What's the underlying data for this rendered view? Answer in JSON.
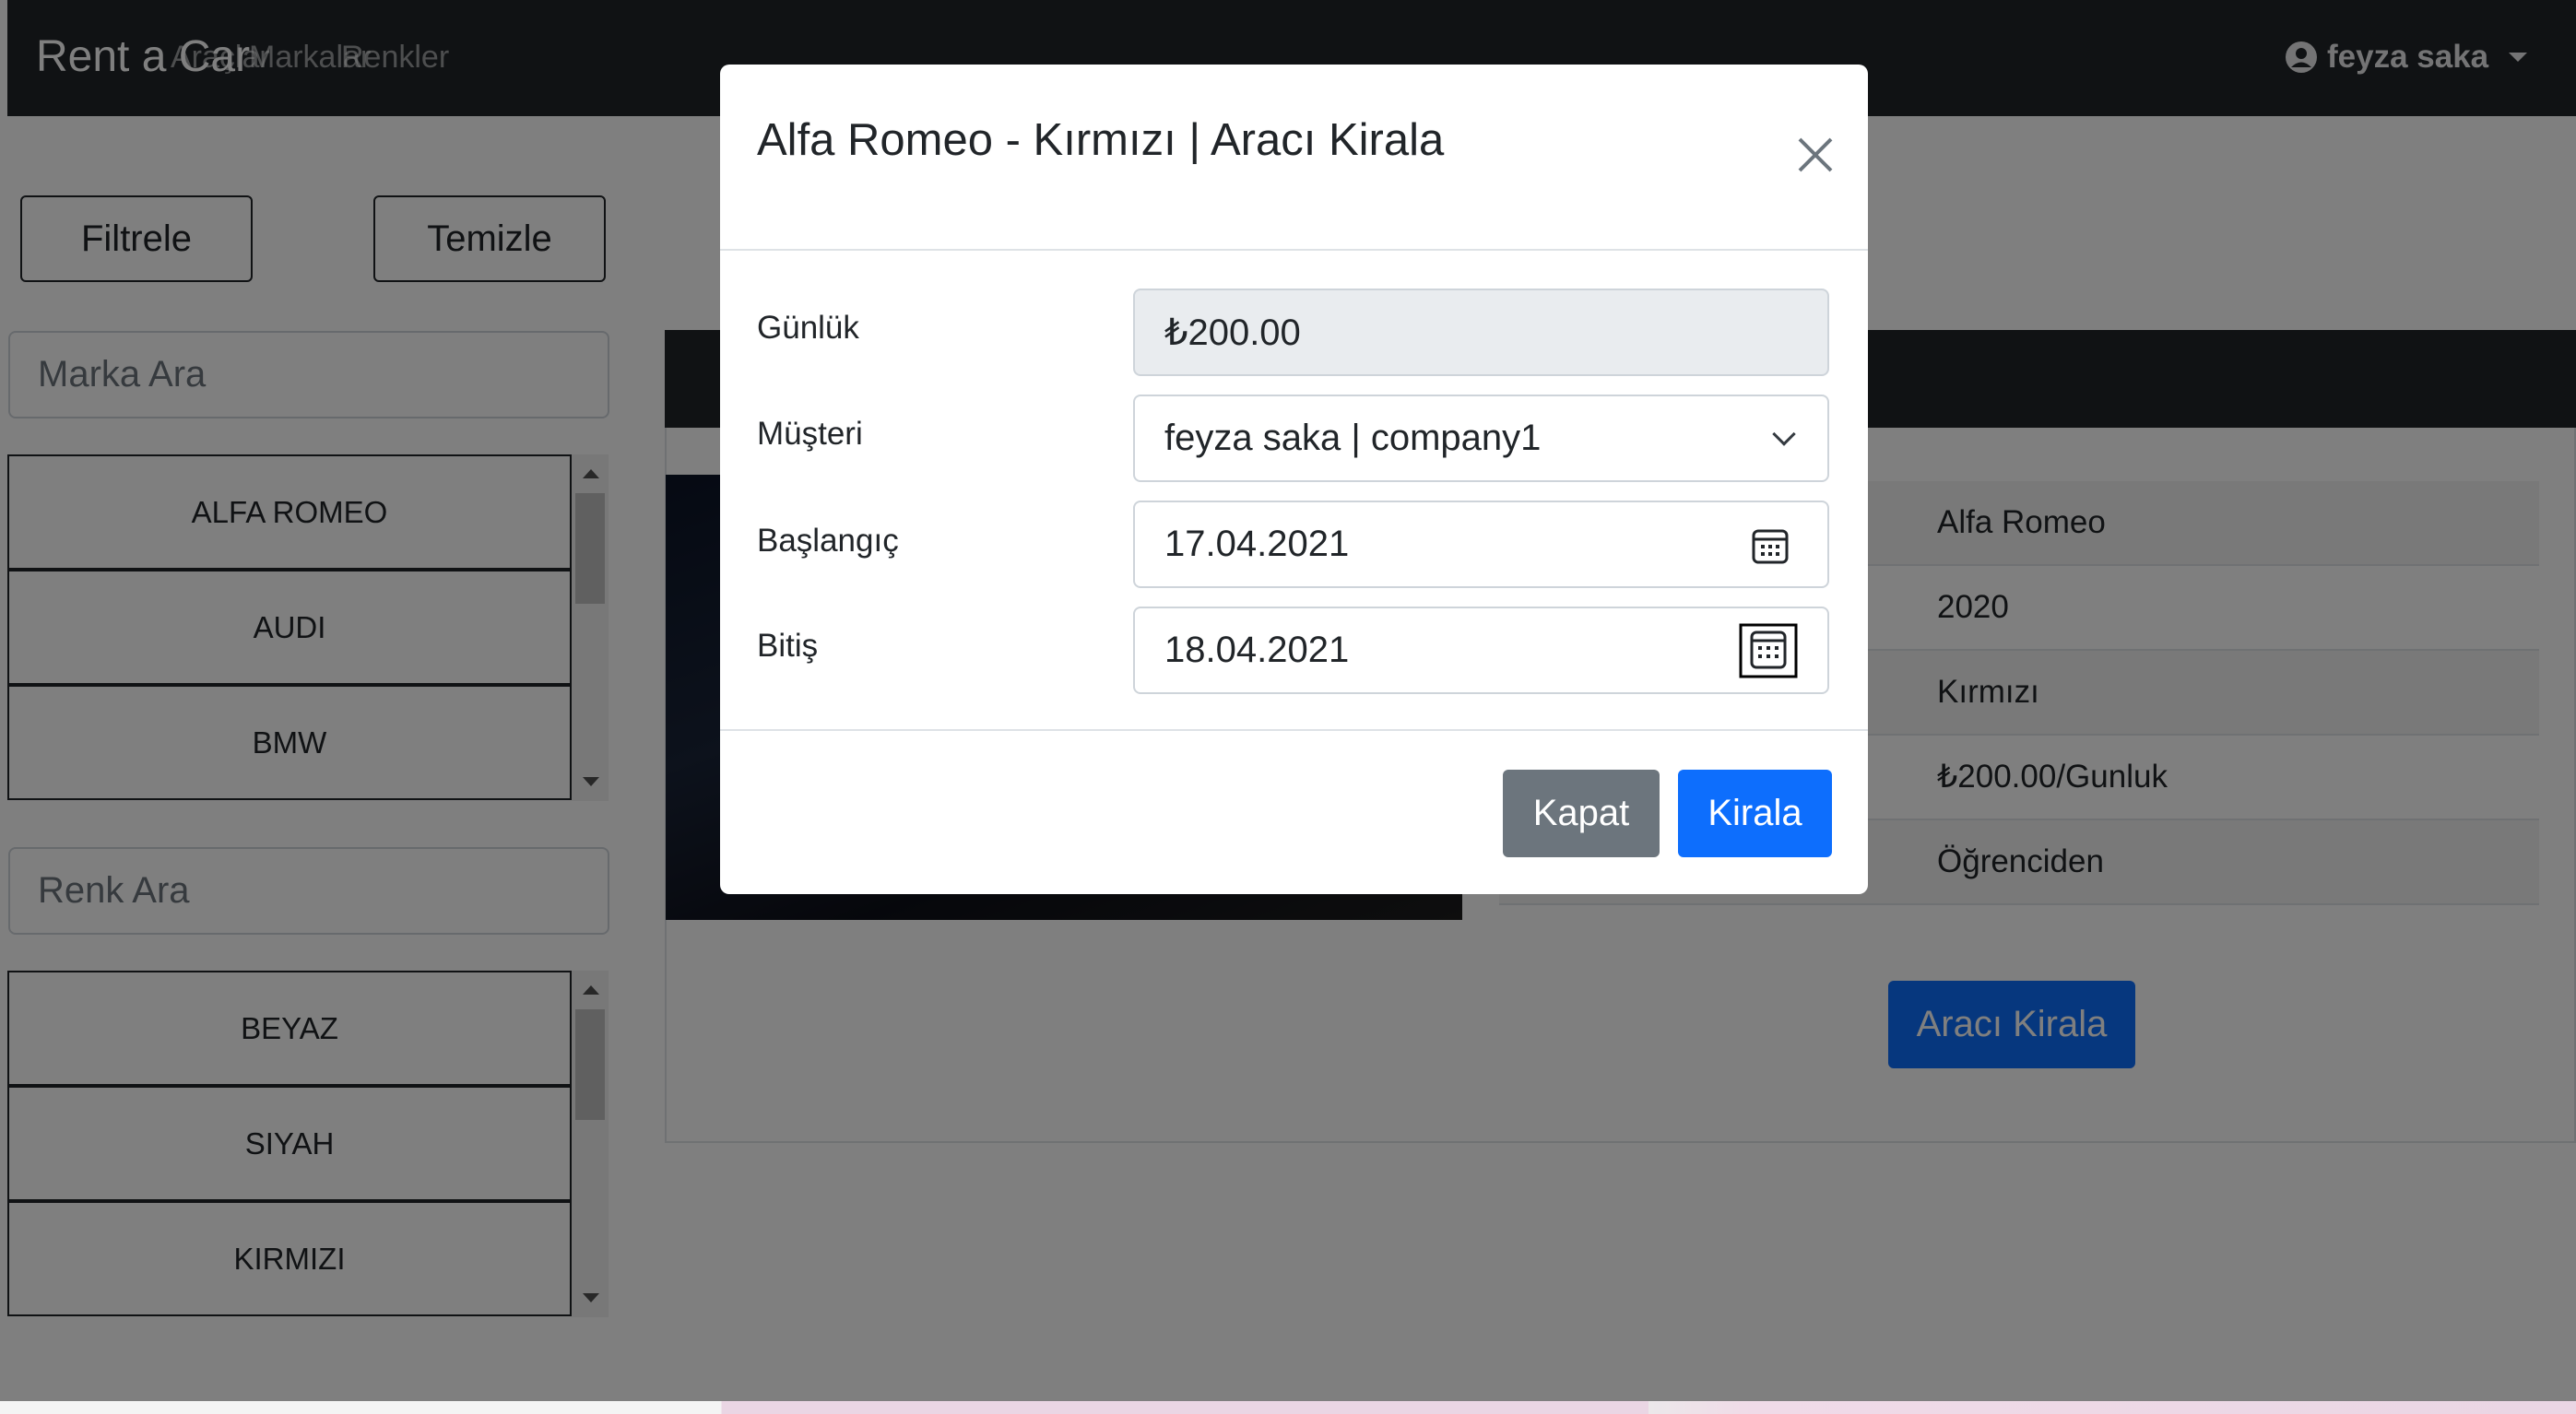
{
  "navbar": {
    "brand": "Rent a Car",
    "links": [
      "Araçlar",
      "Markalar",
      "Renkler"
    ],
    "user": "feyza saka"
  },
  "sidebar": {
    "filter_label": "Filtrele",
    "clear_label": "Temizle",
    "brand_search_placeholder": "Marka Ara",
    "brands": [
      "ALFA ROMEO",
      "AUDI",
      "BMW"
    ],
    "color_search_placeholder": "Renk Ara",
    "colors": [
      "BEYAZ",
      "SIYAH",
      "KIRMIZI"
    ]
  },
  "car_details": {
    "rows": [
      "Alfa Romeo",
      "2020",
      "Kırmızı",
      "₺200.00/Gunluk",
      "Öğrenciden"
    ],
    "rent_button": "Aracı Kirala"
  },
  "modal": {
    "title": "Alfa Romeo - Kırmızı | Aracı Kirala",
    "fields": {
      "daily_label": "Günlük",
      "daily_value": "₺200.00",
      "customer_label": "Müşteri",
      "customer_value": "feyza saka | company1",
      "start_label": "Başlangıç",
      "start_value": "17.04.2021",
      "end_label": "Bitiş",
      "end_value": "18.04.2021"
    },
    "close_label": "Kapat",
    "rent_label": "Kirala"
  }
}
